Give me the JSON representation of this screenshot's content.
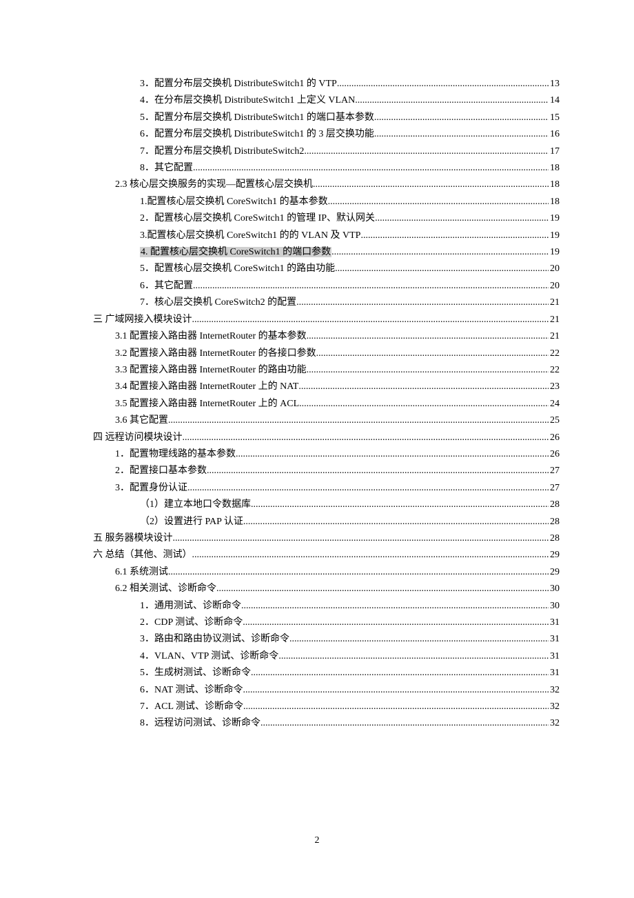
{
  "page_number": "2",
  "toc": [
    {
      "indent": 2,
      "label": "3．配置分布层交换机 DistributeSwitch1 的 VTP",
      "page": "13",
      "hl": false
    },
    {
      "indent": 2,
      "label": "4．在分布层交换机 DistributeSwitch1 上定义 VLAN",
      "page": "14",
      "hl": false
    },
    {
      "indent": 2,
      "label": "5．配置分布层交换机 DistributeSwitch1 的端口基本参数",
      "page": "15",
      "hl": false
    },
    {
      "indent": 2,
      "label": "6．配置分布层交换机 DistributeSwitch1 的 3 层交换功能",
      "page": "16",
      "hl": false
    },
    {
      "indent": 2,
      "label": "7．配置分布层交换机 DistributeSwitch2",
      "page": "17",
      "hl": false
    },
    {
      "indent": 2,
      "label": "8．其它配置",
      "page": "18",
      "hl": false
    },
    {
      "indent": 1,
      "label": "2.3 核心层交换服务的实现—配置核心层交换机",
      "page": "18",
      "hl": false
    },
    {
      "indent": 2,
      "label": "1.配置核心层交换机 CoreSwitch1 的基本参数",
      "page": "18",
      "hl": false
    },
    {
      "indent": 2,
      "label": "2．配置核心层交换机 CoreSwitch1 的管理 IP、默认网关",
      "page": "19",
      "hl": false
    },
    {
      "indent": 2,
      "label": "3.配置核心层交换机 CoreSwitch1 的的 VLAN 及 VTP",
      "page": "19",
      "hl": false
    },
    {
      "indent": 2,
      "label": "4. 配置核心层交换机 CoreSwitch1 的端口参数",
      "page": "19",
      "hl": true
    },
    {
      "indent": 2,
      "label": "5．配置核心层交换机 CoreSwitch1 的路由功能",
      "page": "20",
      "hl": false
    },
    {
      "indent": 2,
      "label": "6．其它配置",
      "page": "20",
      "hl": false
    },
    {
      "indent": 2,
      "label": "7．核心层交换机 CoreSwitch2 的配置",
      "page": "21",
      "hl": false
    },
    {
      "indent": 0,
      "label": "三  广域网接入模块设计",
      "page": "21",
      "hl": false
    },
    {
      "indent": 1,
      "label": "3.1 配置接入路由器 InternetRouter 的基本参数",
      "page": "21",
      "hl": false
    },
    {
      "indent": 1,
      "label": "3.2 配置接入路由器 InternetRouter 的各接口参数",
      "page": "22",
      "hl": false
    },
    {
      "indent": 1,
      "label": "3.3 配置接入路由器 InternetRouter 的路由功能",
      "page": "22",
      "hl": false
    },
    {
      "indent": 1,
      "label": "3.4 配置接入路由器 InternetRouter 上的 NAT",
      "page": "23",
      "hl": false
    },
    {
      "indent": 1,
      "label": "3.5 配置接入路由器 InternetRouter 上的 ACL",
      "page": "24",
      "hl": false
    },
    {
      "indent": 1,
      "label": "3.6 其它配置",
      "page": "25",
      "hl": false
    },
    {
      "indent": 0,
      "label": "四  远程访问模块设计",
      "page": "26",
      "hl": false
    },
    {
      "indent": 1,
      "label": "1．配置物理线路的基本参数",
      "page": "26",
      "hl": false
    },
    {
      "indent": 1,
      "label": "2．配置接口基本参数",
      "page": "27",
      "hl": false
    },
    {
      "indent": 1,
      "label": "3．配置身份认证",
      "page": "27",
      "hl": false
    },
    {
      "indent": 2,
      "label": "（1）建立本地口令数据库",
      "page": "28",
      "hl": false
    },
    {
      "indent": 2,
      "label": "（2）设置进行 PAP 认证",
      "page": "28",
      "hl": false
    },
    {
      "indent": 0,
      "label": "五  服务器模块设计",
      "page": "28",
      "hl": false
    },
    {
      "indent": 0,
      "label": "六  总结（其他、测试）",
      "page": "29",
      "hl": false
    },
    {
      "indent": 1,
      "label": "6.1 系统测试",
      "page": "29",
      "hl": false
    },
    {
      "indent": 1,
      "label": "6.2 相关测试、诊断命令",
      "page": "30",
      "hl": false
    },
    {
      "indent": 2,
      "label": "1．通用测试、诊断命令",
      "page": "30",
      "hl": false
    },
    {
      "indent": 2,
      "label": "2．CDP 测试、诊断命令",
      "page": "31",
      "hl": false
    },
    {
      "indent": 2,
      "label": "3．路由和路由协议测试、诊断命令",
      "page": "31",
      "hl": false
    },
    {
      "indent": 2,
      "label": "4．VLAN、VTP 测试、诊断命令",
      "page": "31",
      "hl": false
    },
    {
      "indent": 2,
      "label": "5．生成树测试、诊断命令",
      "page": "31",
      "hl": false
    },
    {
      "indent": 2,
      "label": "6．NAT 测试、诊断命令",
      "page": "32",
      "hl": false
    },
    {
      "indent": 2,
      "label": "7．ACL 测试、诊断命令",
      "page": "32",
      "hl": false
    },
    {
      "indent": 2,
      "label": "8．远程访问测试、诊断命令",
      "page": "32",
      "hl": false
    }
  ]
}
